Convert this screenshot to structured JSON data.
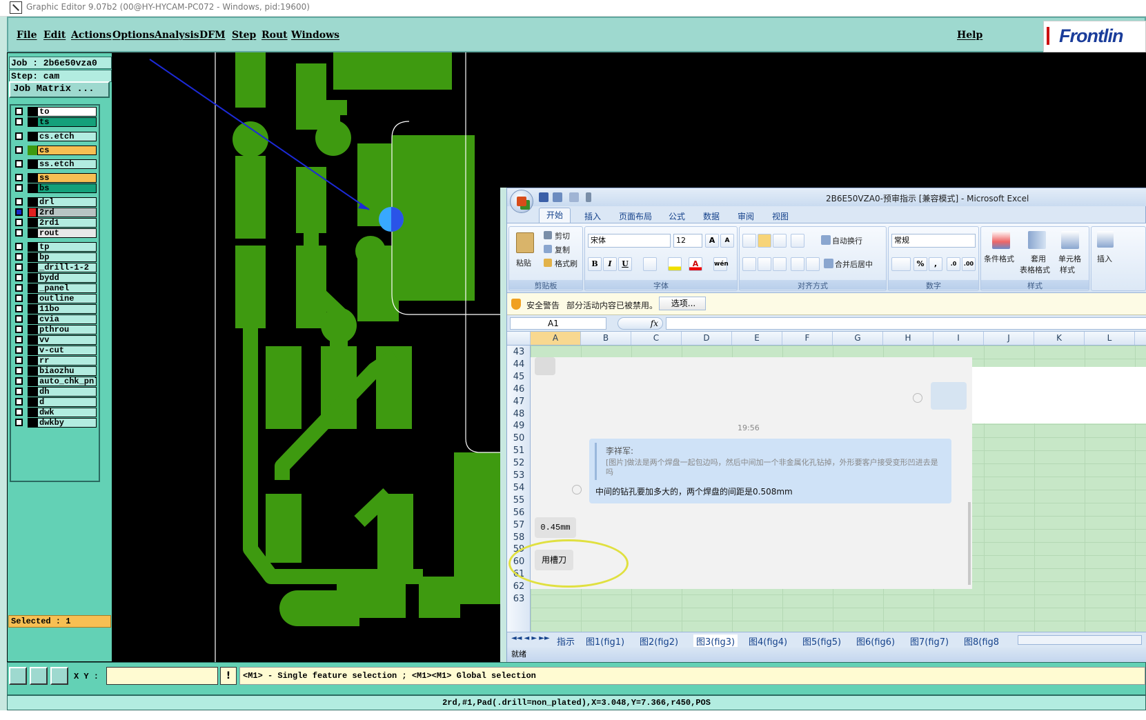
{
  "titlebar": {
    "title": "Graphic Editor 9.07b2 (00@HY-HYCAM-PC072 - Windows, pid:19600)"
  },
  "menu": {
    "items": [
      "File",
      "Edit",
      "Actions",
      "Options",
      "Analysis",
      "DFM",
      "Step",
      "Rout",
      "Windows"
    ],
    "help": "Help",
    "logo": "Frontlin"
  },
  "job": {
    "job": "Job : 2b6e50vza0",
    "step": "Step: cam",
    "matrix_button": "Job Matrix ..."
  },
  "layers": [
    {
      "name": "to",
      "color": "#ffffff"
    },
    {
      "name": "ts",
      "color": "#14a07a"
    },
    {
      "name": "cs.etch",
      "color": "#b2ece0"
    },
    {
      "name": "cs",
      "color": "#f7bf53"
    },
    {
      "name": "ss.etch",
      "color": "#b2ece0"
    },
    {
      "name": "ss",
      "color": "#f7bf53"
    },
    {
      "name": "bs",
      "color": "#14a07a"
    },
    {
      "name": "drl",
      "color": "#b2ece0"
    },
    {
      "name": "2rd",
      "color": "#b8c4c4"
    },
    {
      "name": "2rd1",
      "color": "#b2ece0"
    },
    {
      "name": "rout",
      "color": "#e8e8e8"
    },
    {
      "name": "tp",
      "color": "#b2ece0"
    },
    {
      "name": "bp",
      "color": "#b2ece0"
    },
    {
      "name": "_drill-1-2",
      "color": "#b2ece0"
    },
    {
      "name": "bydd",
      "color": "#b2ece0"
    },
    {
      "name": "_panel",
      "color": "#b2ece0"
    },
    {
      "name": "outline",
      "color": "#b2ece0"
    },
    {
      "name": "11bo",
      "color": "#b2ece0"
    },
    {
      "name": "cvia",
      "color": "#b2ece0"
    },
    {
      "name": "pthrou",
      "color": "#b2ece0"
    },
    {
      "name": "vv",
      "color": "#b2ece0"
    },
    {
      "name": "v-cut",
      "color": "#b2ece0"
    },
    {
      "name": "rr",
      "color": "#b2ece0"
    },
    {
      "name": "biaozhu",
      "color": "#b2ece0"
    },
    {
      "name": "auto_chk_pnl",
      "color": "#b2ece0"
    },
    {
      "name": "dh",
      "color": "#b2ece0"
    },
    {
      "name": "d",
      "color": "#b2ece0"
    },
    {
      "name": "dwk",
      "color": "#b2ece0"
    },
    {
      "name": "dwkby",
      "color": "#b2ece0"
    }
  ],
  "selected": "Selected : 1",
  "bottom": {
    "xy_label": "X Y :",
    "coord_value": "",
    "info_button": "!",
    "hint": "<M1> - Single feature selection ; <M1><M1> Global selection",
    "status": "2rd,#1,Pad(.drill=non_plated),X=3.048,Y=7.366,r450,POS"
  },
  "excel": {
    "title": "2B6E50VZA0-预审指示  [兼容模式] - Microsoft Excel",
    "tabs": [
      "开始",
      "插入",
      "页面布局",
      "公式",
      "数据",
      "审阅",
      "视图"
    ],
    "clipboard": {
      "paste": "粘贴",
      "cut": "剪切",
      "copy": "复制",
      "format_painter": "格式刷",
      "label": "剪贴板"
    },
    "font": {
      "name": "宋体",
      "size": "12",
      "label": "字体",
      "bold": "B",
      "italic": "I",
      "underline": "U"
    },
    "align": {
      "wrap": "自动换行",
      "merge": "合并后居中",
      "label": "对齐方式"
    },
    "number": {
      "format": "常规",
      "percent": "%",
      "comma": ",",
      "label": "数字"
    },
    "styles": {
      "conditional": "条件格式",
      "table_line1": "套用",
      "table_line2": "表格格式",
      "cell_line1": "单元格",
      "cell_line2": "样式",
      "label": "样式"
    },
    "insert": "插入",
    "warning": {
      "title": "安全警告",
      "text": "部分活动内容已被禁用。",
      "button": "选项..."
    },
    "namebox": "A1",
    "fx": "fx",
    "columns": [
      "A",
      "B",
      "C",
      "D",
      "E",
      "F",
      "G",
      "H",
      "I",
      "J",
      "K",
      "L"
    ],
    "rows": [
      "43",
      "44",
      "45",
      "46",
      "47",
      "48",
      "49",
      "50",
      "51",
      "52",
      "53",
      "54",
      "55",
      "56",
      "57",
      "58",
      "59",
      "60",
      "61",
      "62",
      "63"
    ],
    "sheets": [
      "指示",
      "图1(fig1)",
      "图2(fig2)",
      "图3(fig3)",
      "图4(fig4)",
      "图5(fig5)",
      "图6(fig6)",
      "图7(fig7)",
      "图8(fig8"
    ],
    "status": "就绪"
  },
  "chat": {
    "time": "19:56",
    "quote_name": "李祥军:",
    "quote_text": "[图片]做法是两个焊盘一起包边吗，然后中间加一个非金属化孔钻掉，外形要客户接受变形凹进去是吗",
    "message": "中间的钻孔要加多大的，两个焊盘的间距是0.508mm",
    "reply1": "0.45mm",
    "reply2": "用槽刀"
  }
}
